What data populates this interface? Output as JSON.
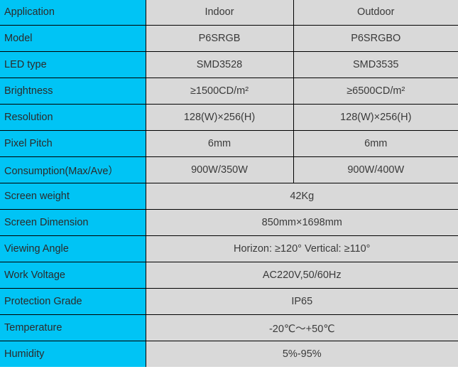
{
  "table": {
    "columns": [
      "Application",
      "Indoor",
      "Outdoor"
    ],
    "rows": [
      {
        "label": "Application",
        "merged": false,
        "indoor": "Indoor",
        "outdoor": "Outdoor"
      },
      {
        "label": "Model",
        "merged": false,
        "indoor": "P6SRGB",
        "outdoor": "P6SRGBO"
      },
      {
        "label": "LED type",
        "merged": false,
        "indoor": "SMD3528",
        "outdoor": "SMD3535"
      },
      {
        "label": "Brightness",
        "merged": false,
        "indoor": "≥1500CD/m²",
        "outdoor": "≥6500CD/m²"
      },
      {
        "label": "Resolution",
        "merged": false,
        "indoor": "128(W)×256(H)",
        "outdoor": "128(W)×256(H)"
      },
      {
        "label": "Pixel Pitch",
        "merged": false,
        "indoor": "6mm",
        "outdoor": "6mm"
      },
      {
        "label": "Consumption(Max/Ave）",
        "merged": false,
        "indoor": "900W/350W",
        "outdoor": "900W/400W"
      },
      {
        "label": "Screen weight",
        "merged": true,
        "value": "42Kg"
      },
      {
        "label": "Screen Dimension",
        "merged": true,
        "value": "850mm×1698mm"
      },
      {
        "label": "Viewing Angle",
        "merged": true,
        "value": "Horizon: ≥120° Vertical: ≥110°"
      },
      {
        "label": "Work Voltage",
        "merged": true,
        "value": "AC220V,50/60Hz"
      },
      {
        "label": "Protection Grade",
        "merged": true,
        "value": "IP65"
      },
      {
        "label": "Temperature",
        "merged": true,
        "value": "-20℃～+50℃"
      },
      {
        "label": "Humidity",
        "merged": true,
        "value": "5%-95%"
      }
    ]
  },
  "colors": {
    "label_background": "#00c4f5",
    "value_background": "#d9d9d9",
    "border": "#000000",
    "text": "#3a3a3a"
  }
}
